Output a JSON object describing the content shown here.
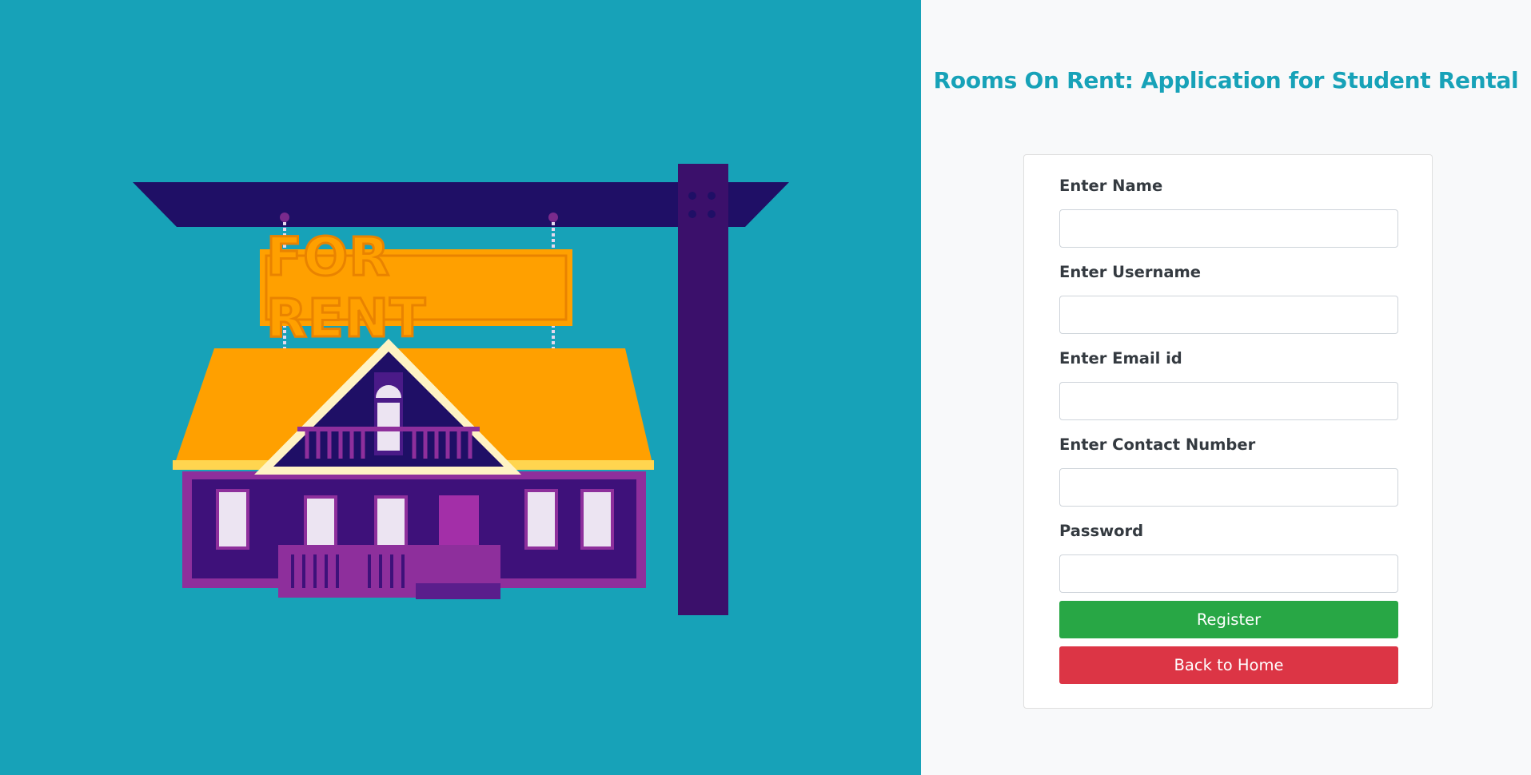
{
  "header": {
    "title": "Rooms On Rent: Application for Student Rental"
  },
  "hero": {
    "sign_text": "FOR RENT",
    "illustration": "house-for-rent-illustration"
  },
  "form": {
    "fields": [
      {
        "label": "Enter Name",
        "value": "",
        "placeholder": ""
      },
      {
        "label": "Enter Username",
        "value": "",
        "placeholder": ""
      },
      {
        "label": "Enter Email id",
        "value": "",
        "placeholder": ""
      },
      {
        "label": "Enter Contact Number",
        "value": "",
        "placeholder": ""
      },
      {
        "label": "Password",
        "value": "",
        "placeholder": ""
      }
    ],
    "register_label": "Register",
    "back_label": "Back to Home"
  },
  "colors": {
    "hero_bg": "#17a2b8",
    "title": "#17a2b8",
    "register": "#28a745",
    "back": "#dc3545"
  }
}
